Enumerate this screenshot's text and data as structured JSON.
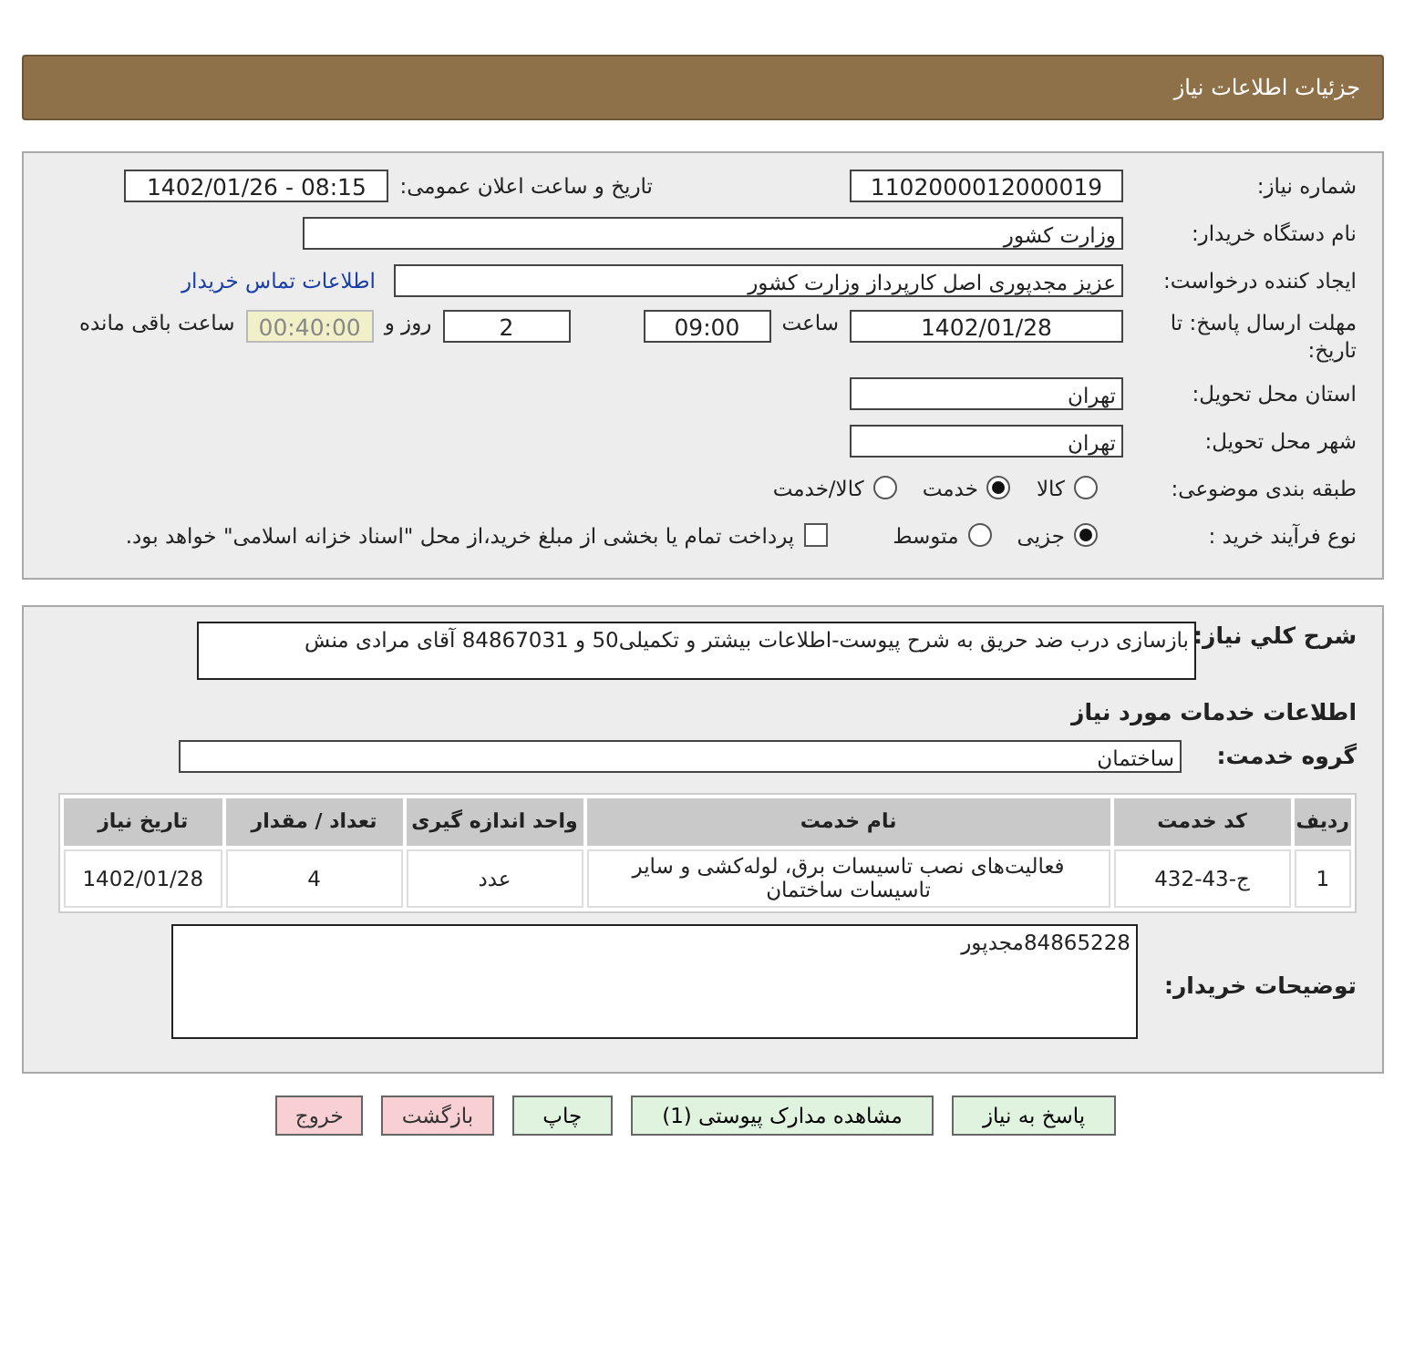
{
  "header": {
    "title": "جزئیات اطلاعات نیاز"
  },
  "details": {
    "need_number": {
      "label": "شماره نیاز:",
      "value": "1102000012000019"
    },
    "announce": {
      "label": "تاریخ و ساعت اعلان عمومی:",
      "value": "1402/01/26 - 08:15"
    },
    "buyer": {
      "label": "نام دستگاه خریدار:",
      "value": "وزارت کشور"
    },
    "requester": {
      "label": "ایجاد کننده درخواست:",
      "value": "عزیز مجدپوری اصل کارپرداز وزارت کشور",
      "link": "اطلاعات تماس خریدار"
    },
    "deadline": {
      "label": "مهلت ارسال پاسخ: تا تاریخ:",
      "date": "1402/01/28",
      "time_label": "ساعت",
      "time": "09:00",
      "days": "2",
      "days_label": "روز و",
      "remaining": "00:40:00",
      "remaining_label": "ساعت باقی مانده"
    },
    "province": {
      "label": "استان محل تحویل:",
      "value": "تهران"
    },
    "city": {
      "label": "شهر محل تحویل:",
      "value": "تهران"
    },
    "category": {
      "label": "طبقه بندی موضوعی:",
      "options": [
        {
          "label": "کالا",
          "selected": false
        },
        {
          "label": "خدمت",
          "selected": true
        },
        {
          "label": "کالا/خدمت",
          "selected": false
        }
      ]
    },
    "process": {
      "label": "نوع فرآیند خرید :",
      "options": [
        {
          "label": "جزیی",
          "selected": true
        },
        {
          "label": "متوسط",
          "selected": false
        }
      ],
      "payment": {
        "checked": false,
        "label": "پرداخت تمام یا بخشی از مبلغ خرید،از محل \"اسناد خزانه اسلامی\" خواهد بود."
      }
    }
  },
  "need": {
    "description_label": "شرح کلي نياز:",
    "description": "بازسازی درب ضد حریق به شرح پیوست-اطلاعات بیشتر و تکمیلی50 و 84867031 آقای مرادی منش",
    "services_title": "اطلاعات خدمات مورد نیاز",
    "group_label": "گروه خدمت:",
    "group": "ساختمان",
    "table": {
      "columns": [
        "ردیف",
        "کد خدمت",
        "نام خدمت",
        "واحد اندازه گیری",
        "تعداد / مقدار",
        "تاریخ نیاز"
      ],
      "rows": [
        [
          "1",
          "ج-43-432",
          "فعالیت‌های نصب تاسیسات برق، لوله‌کشی و سایر تاسیسات ساختمان",
          "عدد",
          "4",
          "1402/01/28"
        ]
      ]
    },
    "notes_label": "توضیحات خریدار:",
    "notes": "84865228مجدپور"
  },
  "buttons": [
    {
      "label": "پاسخ به نیاز",
      "kind": "action"
    },
    {
      "label": "مشاهده مدارک پیوستی (1)",
      "kind": "action"
    },
    {
      "label": "چاپ",
      "kind": "action"
    },
    {
      "label": "بازگشت",
      "kind": "exit"
    },
    {
      "label": "خروج",
      "kind": "exit"
    }
  ]
}
